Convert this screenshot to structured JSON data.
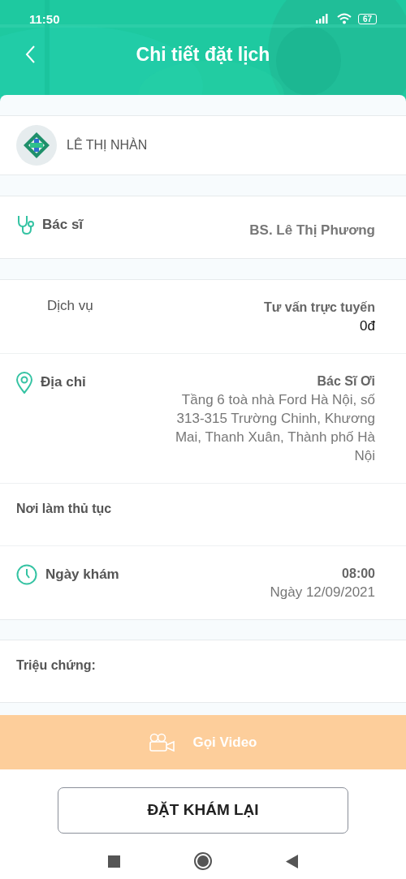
{
  "status_bar": {
    "time": "11:50",
    "battery": "67"
  },
  "header": {
    "title": "Chi tiết đặt lịch"
  },
  "clinic": {
    "name": "LÊ THỊ NHÀN"
  },
  "sections": [
    {
      "rows": [
        {
          "kind": "stethoscope",
          "label": "Bác sĩ",
          "values": [
            {
              "kind": "plain-strong",
              "text": "BS. Lê Thị Phương"
            }
          ]
        }
      ]
    },
    {
      "rows": [
        {
          "kind": "plain",
          "label": "Dịch vụ",
          "values": [
            {
              "kind": "strong",
              "text": "Tư vấn trực tuyến"
            },
            {
              "kind": "price",
              "text": "0đ"
            }
          ]
        },
        {
          "kind": "pin",
          "label": "Địa chỉ",
          "values": [
            {
              "kind": "strong",
              "text": "Bác Sĩ Ơi"
            },
            {
              "kind": "plain",
              "text": "Tầng 6 toà nhà Ford Hà Nội, số 313-315 Trường Chinh, Khương Mai, Thanh Xuân, Thành phố Hà Nội"
            }
          ]
        },
        {
          "kind": "plain",
          "label": "Nơi làm thủ tục",
          "values": []
        },
        {
          "kind": "clock",
          "label": "Ngày khám",
          "values": [
            {
              "kind": "strong",
              "text": "08:00"
            },
            {
              "kind": "plain",
              "text": "Ngày 12/09/2021"
            }
          ]
        }
      ]
    },
    {
      "rows": [
        {
          "kind": "plain",
          "label": "Triệu chứng:",
          "values": []
        }
      ]
    }
  ],
  "video_button": {
    "label": "Gọi Video",
    "disabled": true
  },
  "rebook_button": {
    "label": "ĐẶT KHÁM LẠI"
  }
}
